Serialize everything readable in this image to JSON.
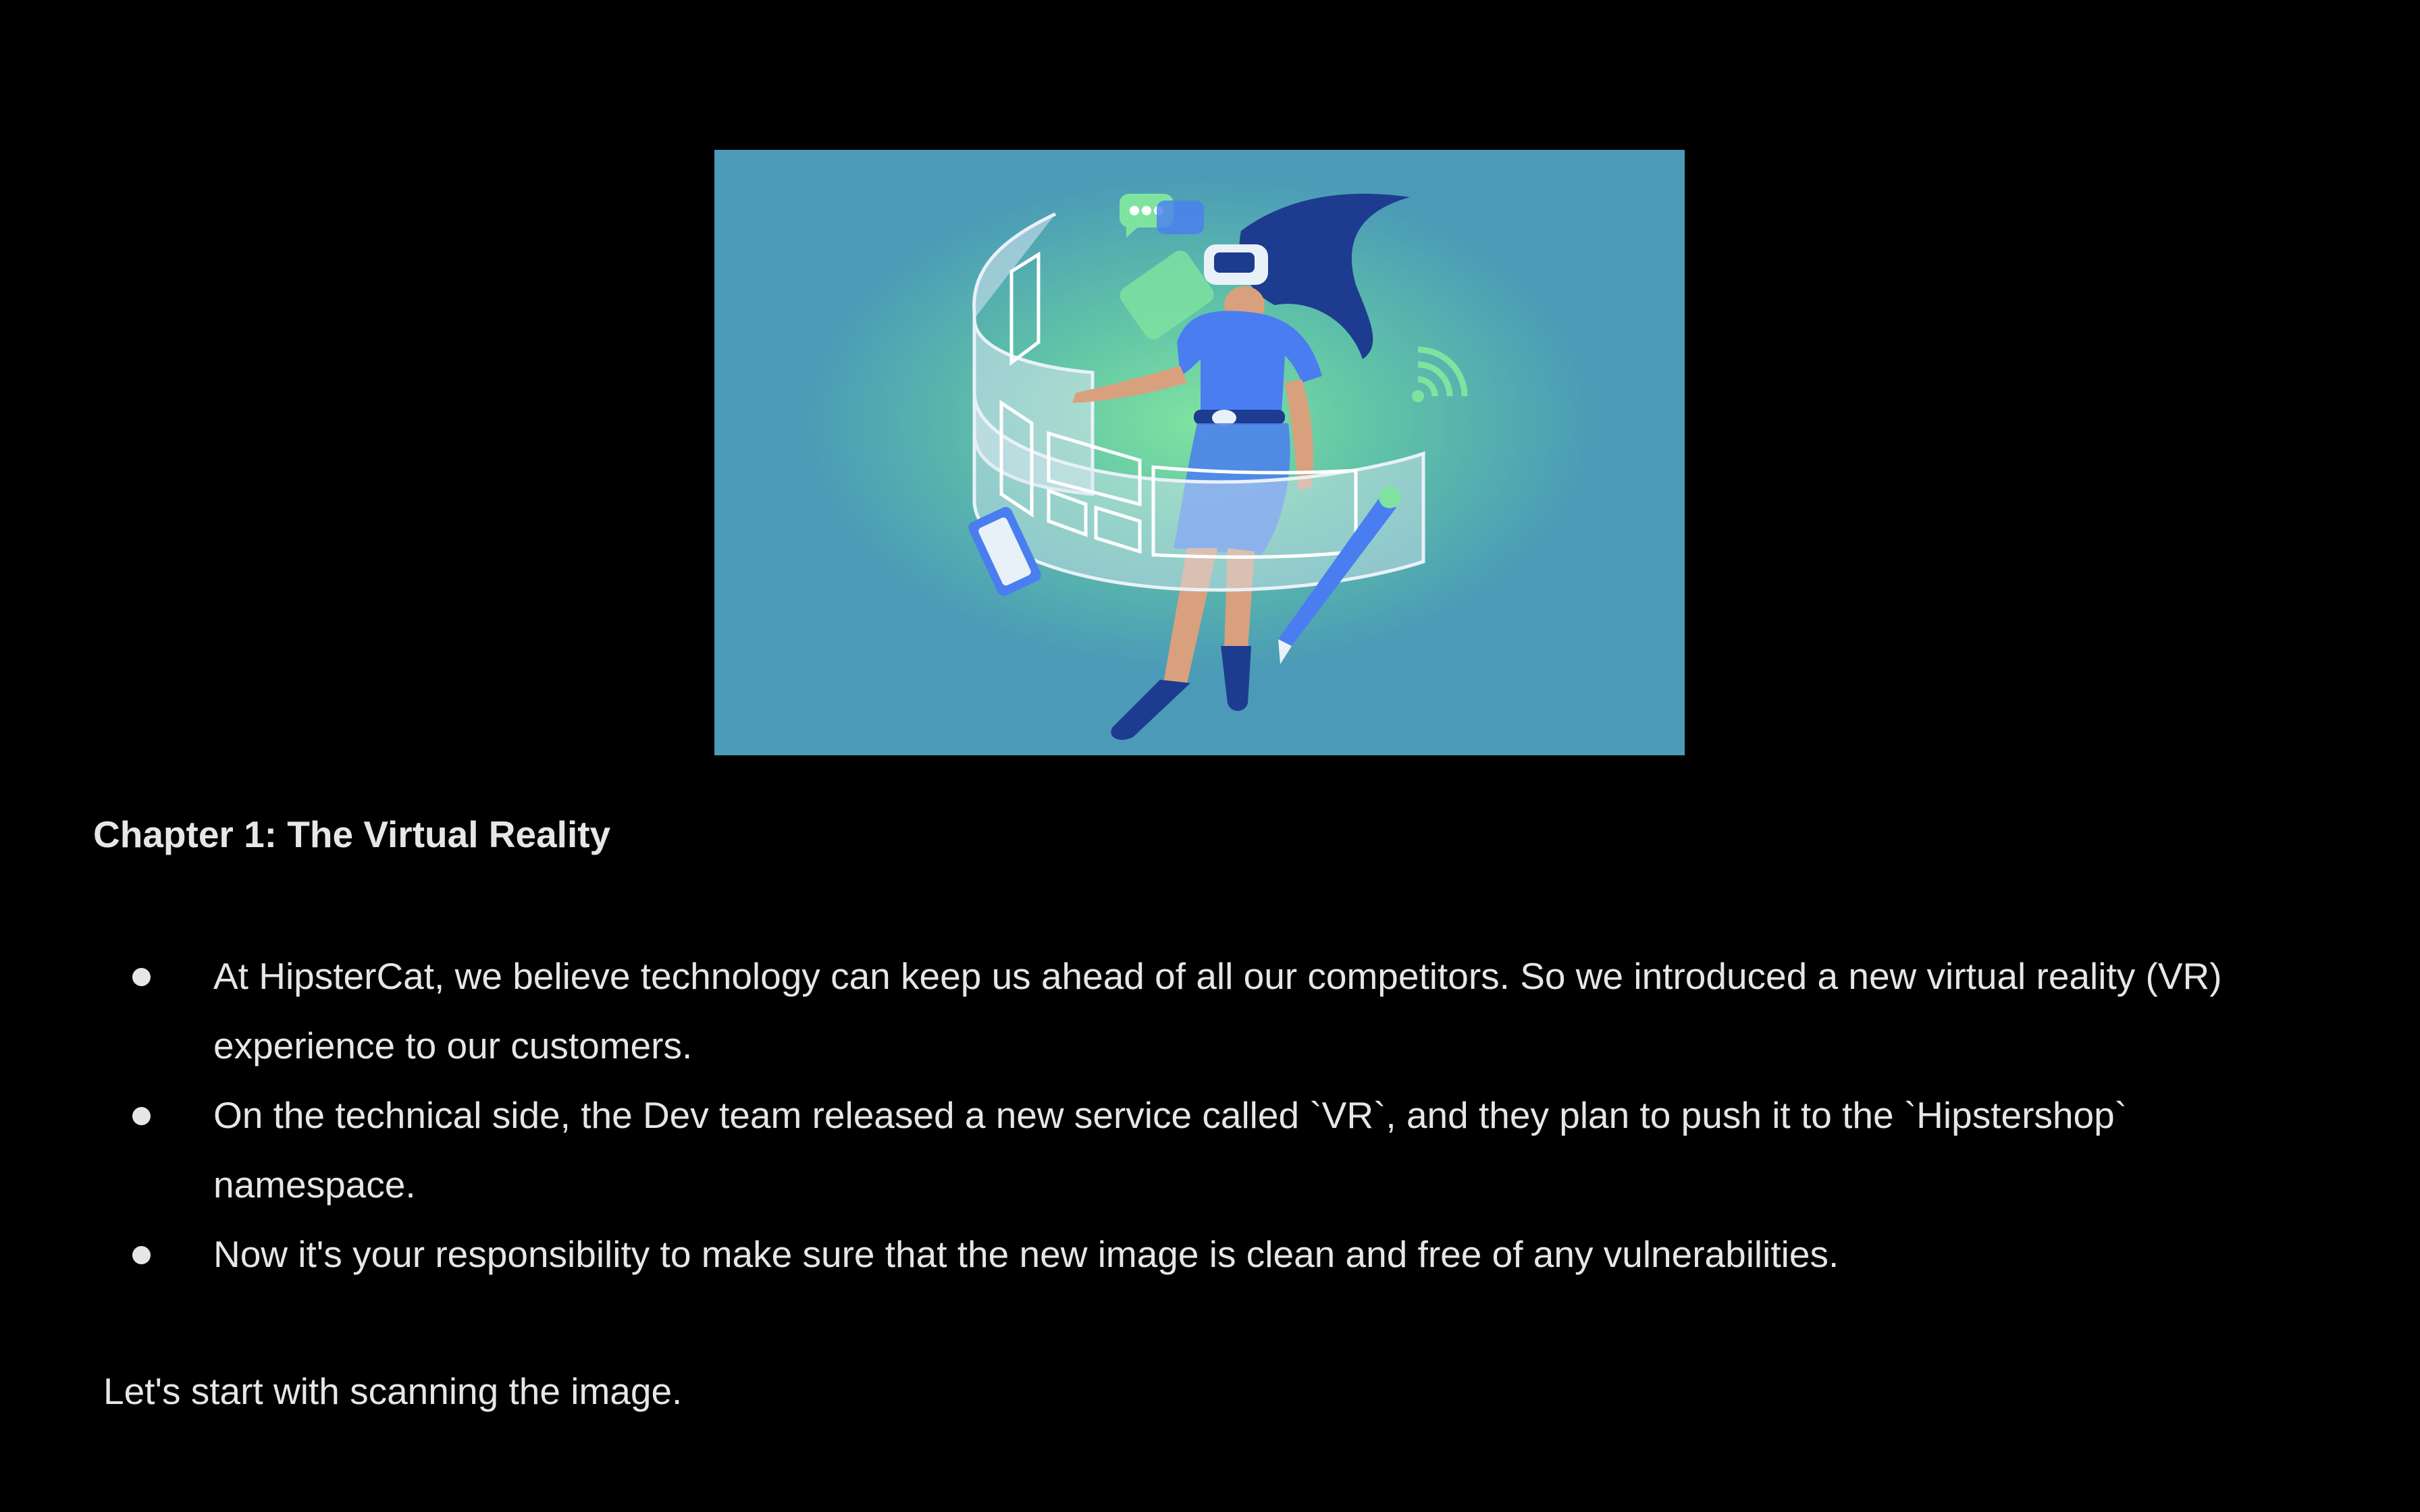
{
  "hero": {
    "icon": "vr-illustration",
    "colors": {
      "background": "#4b9ab7",
      "glow": "#6fd59c",
      "figure": "#4a7ef0",
      "hair": "#1d3c8f",
      "panel": "#d9e6f2"
    }
  },
  "chapter": {
    "title": "Chapter 1: The Virtual Reality"
  },
  "bullets": [
    {
      "text": "At HipsterCat, we believe technology can keep us ahead of all our competitors. So we introduced a new virtual reality (VR) experience to our customers."
    },
    {
      "text": "On the technical side, the Dev team released a new service called `VR`, and they plan to push it to the `Hipstershop` namespace."
    },
    {
      "text": "Now it's your responsibility to make sure that the new image is clean and free of any vulnerabilities."
    }
  ],
  "closing": {
    "text": "Let's start with scanning the image."
  }
}
